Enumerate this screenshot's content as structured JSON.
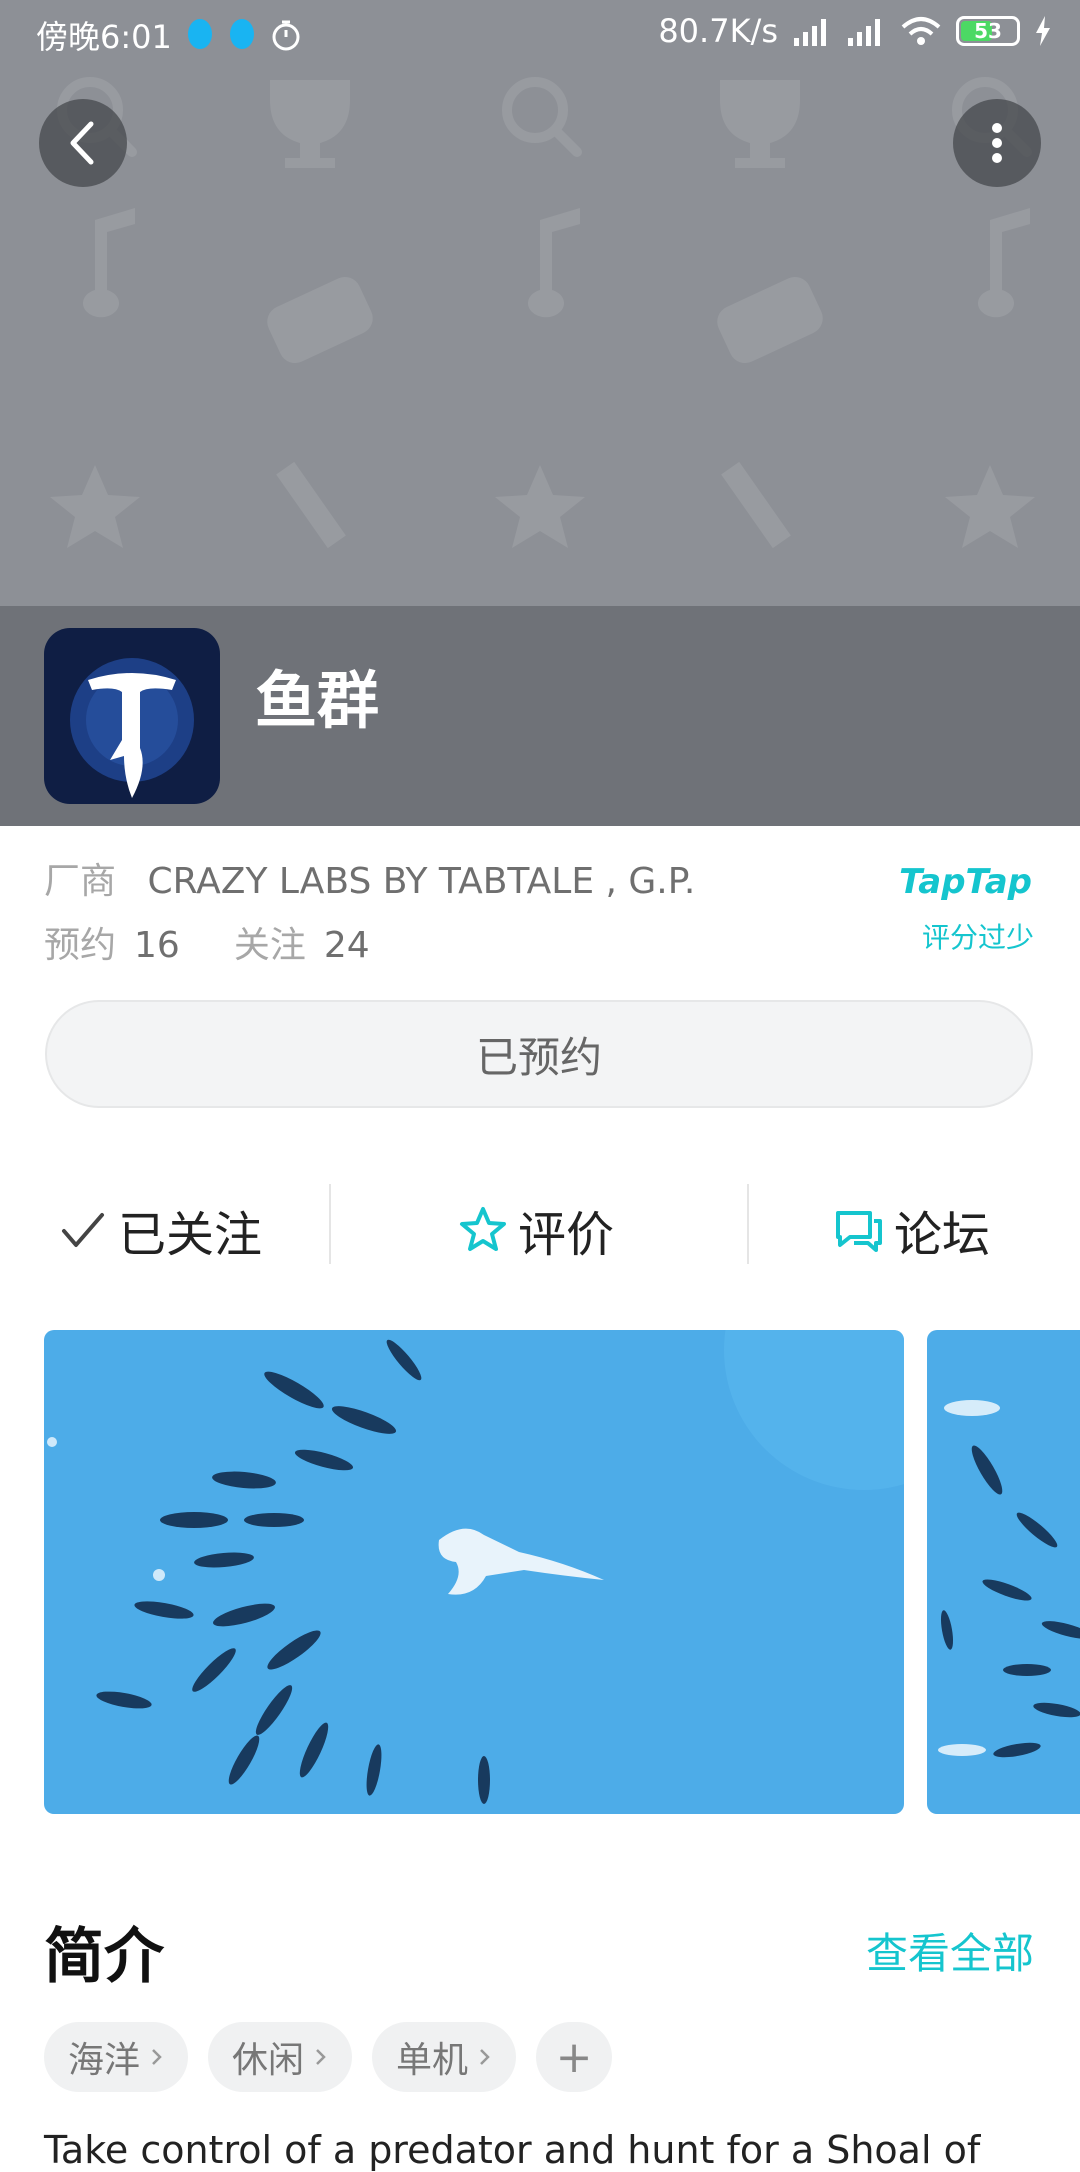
{
  "status_bar": {
    "time": "傍晚6:01",
    "network_speed": "80.7K/s",
    "battery": "53"
  },
  "header": {
    "back_icon": "chevron-left-icon",
    "more_icon": "vertical-dots-icon"
  },
  "app": {
    "name": "鱼群"
  },
  "info": {
    "developer_label": "厂商",
    "developer": "CRAZY LABS BY TABTALE , G.P.",
    "reserve_label": "预约",
    "reserve_count": "16",
    "follow_label": "关注",
    "follow_count": "24",
    "brand": "TapTap",
    "rating_text": "评分过少"
  },
  "reserve_button": {
    "label": "已预约"
  },
  "actions": {
    "follow": "已关注",
    "review": "评价",
    "forum": "论坛"
  },
  "intro": {
    "title": "简介",
    "view_all": "查看全部",
    "tags": [
      "海洋",
      "休闲",
      "单机"
    ],
    "add_tag": "+",
    "description": "Take control of a predator and hunt for a Shoal of"
  },
  "colors": {
    "accent": "#15c5ce",
    "header_bg": "#8d9096",
    "title_band": "#6f7278",
    "screenshot_blue": "#4dace8"
  }
}
